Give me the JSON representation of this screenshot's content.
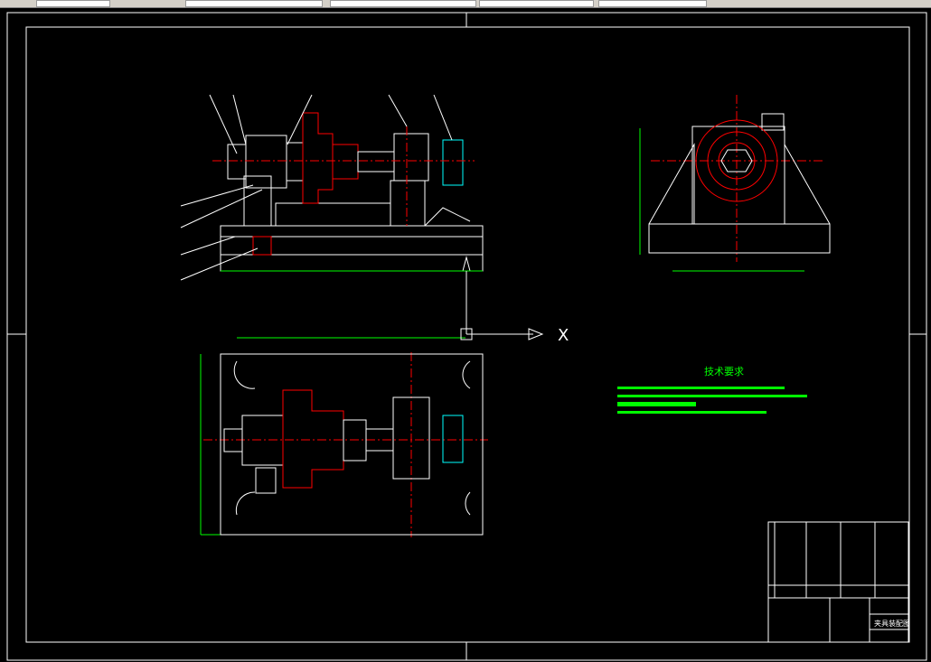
{
  "app": {
    "background": "#000000"
  },
  "drawing": {
    "axis_x_label": "X",
    "tech_requirements_title": "技术要求",
    "title_block_drawing_name": "夹具装配图"
  },
  "colors": {
    "outline": "#ffffff",
    "center_line": "#ff0000",
    "hatch": "#ff0000",
    "dimension": "#00ff00",
    "section": "#00ffff"
  }
}
